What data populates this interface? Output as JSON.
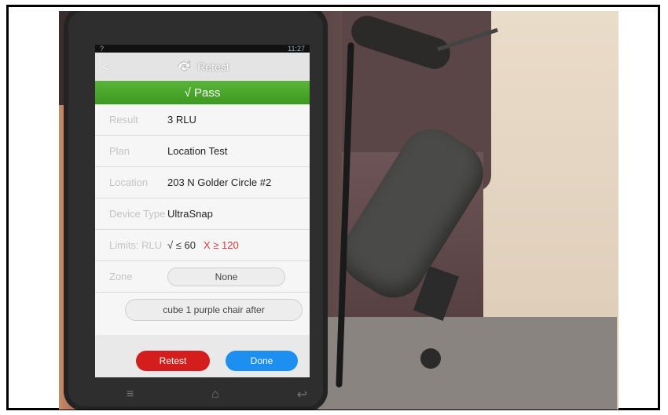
{
  "status": {
    "time": "11:27",
    "left_glyph": "?"
  },
  "header": {
    "back_glyph": "<",
    "title": "Retest"
  },
  "result_banner": "√ Pass",
  "fields": [
    {
      "label": "Result",
      "value": "3 RLU"
    },
    {
      "label": "Plan",
      "value": "Location Test"
    },
    {
      "label": "Location",
      "value": "203 N Golder Circle #2"
    },
    {
      "label": "Device Type",
      "value": "UltraSnap"
    }
  ],
  "limits": {
    "label": "Limits: RLU",
    "pass": "√ ≤ 60",
    "fail": "X ≥ 120"
  },
  "zone": {
    "label": "Zone",
    "value": "None"
  },
  "notes": "cube 1 purple chair after",
  "actions": {
    "retest": "Retest",
    "done": "Done"
  },
  "navbar": {
    "menu": "≡",
    "home": "⌂",
    "back": "↩"
  },
  "colors": {
    "pass_green": "#3c9a1e",
    "retest_red": "#d41e1e",
    "done_blue": "#1d8ff0"
  }
}
